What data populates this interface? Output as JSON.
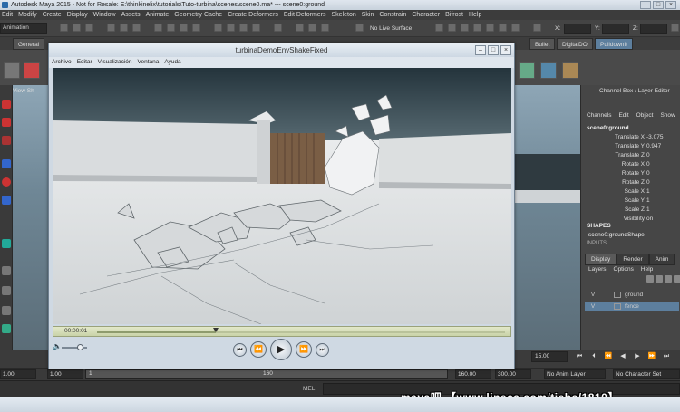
{
  "maya": {
    "title": "Autodesk Maya 2015 - Not for Resale: E:\\thinkinelix\\tutorials\\Tuto-turbina\\scenes\\scene0.ma* --- scene0:ground",
    "menus": [
      "Edit",
      "Modify",
      "Create",
      "Display",
      "Window",
      "Assets",
      "Animate",
      "Geometry Cache",
      "Create Deformers",
      "Edit Deformers",
      "Skeleton",
      "Skin",
      "Constrain",
      "Character",
      "Bifrost",
      "Help"
    ],
    "mode": "Animation",
    "live_surface": "No Live Surface",
    "coord_labels": [
      "X:",
      "Y:",
      "Z:"
    ],
    "shelf_tabs": [
      "General",
      "Bullet",
      "DigitalDO",
      "PulldownIt"
    ],
    "viewport_menu": "View   Sh"
  },
  "channel_box": {
    "header": "Channel Box / Layer Editor",
    "menus": [
      "Channels",
      "Edit",
      "Object",
      "Show"
    ],
    "object": "scene0:ground",
    "attributes": [
      {
        "label": "Translate X",
        "value": "-3.075"
      },
      {
        "label": "Translate Y",
        "value": "0.947"
      },
      {
        "label": "Translate Z",
        "value": "0"
      },
      {
        "label": "Rotate X",
        "value": "0"
      },
      {
        "label": "Rotate Y",
        "value": "0"
      },
      {
        "label": "Rotate Z",
        "value": "0"
      },
      {
        "label": "Scale X",
        "value": "1"
      },
      {
        "label": "Scale Y",
        "value": "1"
      },
      {
        "label": "Scale Z",
        "value": "1"
      },
      {
        "label": "Visibility",
        "value": "on"
      }
    ],
    "shapes_header": "SHAPES",
    "shape_name": "scene0:groundShape",
    "inputs_header": "INPUTS"
  },
  "layers": {
    "tabs": [
      "Display",
      "Render",
      "Anim"
    ],
    "menus": [
      "Layers",
      "Options",
      "Help"
    ],
    "rows": [
      {
        "visible": "V",
        "name": "ground"
      },
      {
        "visible": "V",
        "name": "fence"
      }
    ]
  },
  "playback": {
    "current_frame": "15.00",
    "range_start": "1.00",
    "range_field": "1.00",
    "range_inner_start": "1",
    "range_inner_end": "160",
    "range_end": "160.00",
    "max_end": "300.00",
    "anim_layer": "No Anim Layer",
    "character_set": "No Character Set",
    "mel_label": "MEL"
  },
  "player": {
    "title": "turbinaDemoEnvShakeFixed",
    "menus": [
      "Archivo",
      "Editar",
      "Visualización",
      "Ventana",
      "Ayuda"
    ],
    "timecode": "00:00:01",
    "progress": 0.29,
    "volume": 0.7
  },
  "watermark": "maya吧 【www.lineca.com/tieba/1810】",
  "colors": {
    "timeline": "#c9d3a8",
    "layer_selected": "#5d7f9e",
    "maya_bg": "#444444"
  }
}
